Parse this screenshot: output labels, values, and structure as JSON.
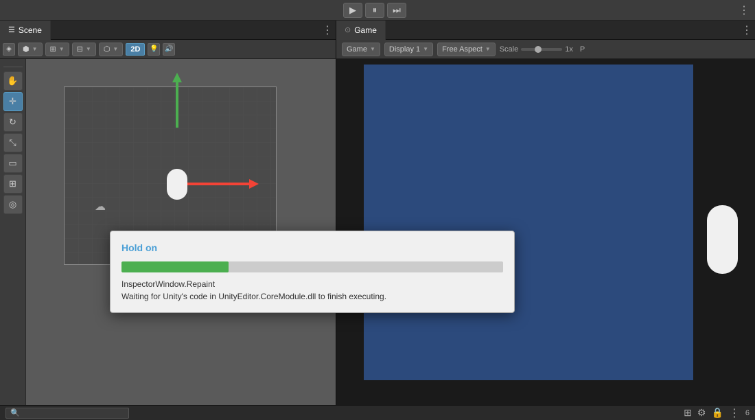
{
  "app": {
    "topbar": {
      "play_btn": "▶",
      "pause_btn": "⏸",
      "step_btn": "⏭"
    }
  },
  "scene_tab": {
    "label": "Scene",
    "icon": "≡"
  },
  "game_tab": {
    "label": "Game",
    "icon": "👁"
  },
  "scene_toolbar": {
    "btn_2d": "2D"
  },
  "game_toolbar": {
    "game_label": "Game",
    "display_label": "Display 1",
    "aspect_label": "Free Aspect",
    "scale_label": "Scale",
    "scale_value": "1x"
  },
  "dialog": {
    "title": "Hold on",
    "progress_percent": 28,
    "status1": "InspectorWindow.Repaint",
    "status2": "Waiting for Unity's code in UnityEditor.CoreModule.dll to finish executing.",
    "progress_color": "#4caf50"
  },
  "bottom": {
    "search_placeholder": "🔍",
    "lock_icon": "🔒",
    "dots_icon": "⋮",
    "num": "6"
  }
}
